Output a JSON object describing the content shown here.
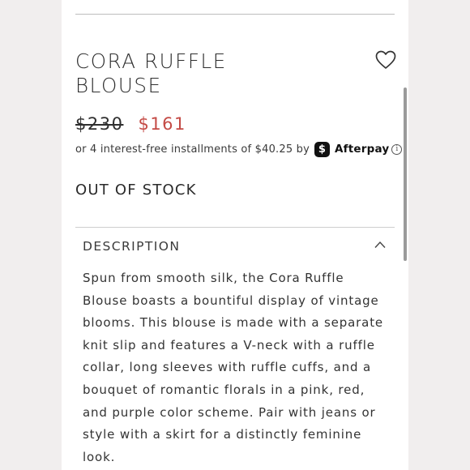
{
  "product": {
    "title_lines": [
      "CORA RUFFLE",
      "BLOUSE"
    ],
    "original_price": "$230",
    "sale_price": "$161",
    "installments_text": "or 4 interest-free installments of $40.25 by",
    "afterpay_badge_glyph": "$",
    "afterpay_name": "Afterpay",
    "info_glyph": "i",
    "stock_status": "OUT OF STOCK"
  },
  "description": {
    "header": "DESCRIPTION",
    "lines": [
      "Spun from smooth silk, the Cora Ruffle",
      "Blouse boasts a bountiful display of vintage",
      "blooms. This blouse is made with a separate",
      "knit slip and features a V-neck with a ruffle",
      "collar, long sleeves with ruffle cuffs, and a",
      "bouquet of romantic florals in a pink, red,",
      "and purple color scheme. Pair with jeans or",
      "style with a skirt for a distinctly feminine",
      "look."
    ]
  },
  "icons": {
    "wishlist": "heart-outline-icon",
    "collapse": "chevron-up-icon",
    "afterpay": "afterpay-logo-icon",
    "info": "info-circle-icon"
  },
  "colors": {
    "sale_price": "#c44a45",
    "page_background": "#f1eeee",
    "card_background": "#ffffff"
  }
}
